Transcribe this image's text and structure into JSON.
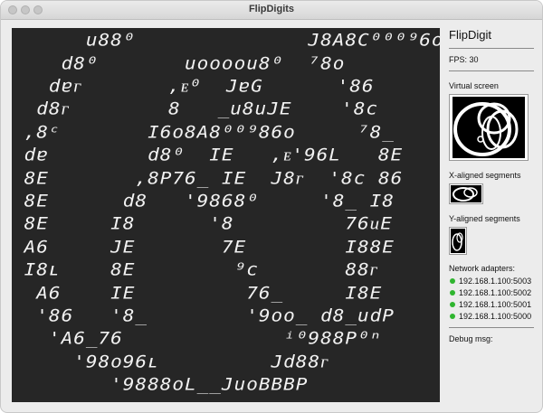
{
  "window": {
    "title": "FlipDigits"
  },
  "screen": {
    "rows": [
      "      u88⁰              J8A8C⁰⁰⁰⁹6o",
      "    d8⁰       uoooou8⁰  ⁷8o        ⁿ",
      "   dɐᴦ       ,ᴇ⁰  JɐG      '86",
      "  d8ᴦ        8   _u8uJE    '8c",
      " ,8ᶜ       I6o8A8⁰⁰⁹86o     ⁷8_",
      " dɐ        d8⁰  IE   ,ᴇ'96L   8E",
      " 8E       ,8P76_ IE  J8ᴦ  '8c 86",
      " 8E      d8   '9868⁰     '8_ I8",
      " 8E     I8      '8         76ᴎE",
      " A6     JE       7E        I88E",
      " I8ʟ    8E        ⁹c       88ᴦ",
      "  A6    IE         76_     I8E",
      "  '86   '8_        '9oo_ d8_udP",
      "   'A6_76             ⁱ⁰988P⁰ⁿ",
      "     '98o96ʟ         Jd88ᴦ",
      "        '9888oL__JuoBBBP"
    ]
  },
  "sidebar": {
    "app_title": "FlipDigit",
    "fps": "FPS: 30",
    "virtual_screen_label": "Virtual screen",
    "x_segments_label": "X-aligned segments",
    "y_segments_label": "Y-aligned segments",
    "network_label": "Network adapters:",
    "adapters": [
      "192.168.1.100:5003",
      "192.168.1.100:5002",
      "192.168.1.100:5001",
      "192.168.1.100:5000"
    ],
    "debug_label": "Debug msg:",
    "status_color": "#2fb52f"
  }
}
